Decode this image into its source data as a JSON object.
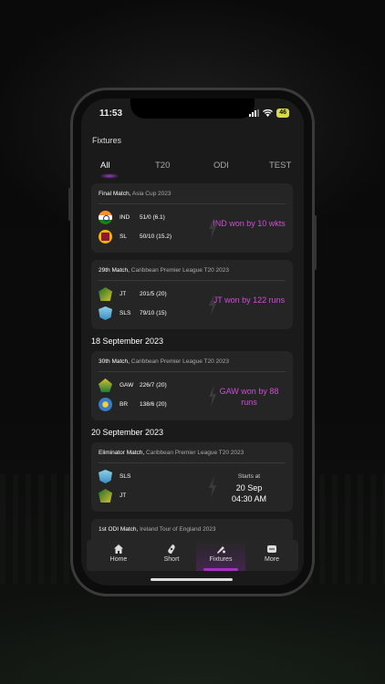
{
  "status": {
    "time": "11:53",
    "battery": "46"
  },
  "header": {
    "title": "Fixtures"
  },
  "tabs": [
    {
      "label": "All"
    },
    {
      "label": "T20"
    },
    {
      "label": "ODI"
    },
    {
      "label": "TEST"
    }
  ],
  "matches": [
    {
      "title": "Final Match,",
      "league": "Asia Cup 2023",
      "team1": {
        "abbr": "IND",
        "score": "51/0 (6.1)"
      },
      "team2": {
        "abbr": "SL",
        "score": "50/10 (15.2)"
      },
      "result": "IND won by 10 wkts"
    },
    {
      "title": "29th Match,",
      "league": "Caribbean Premier League T20 2023",
      "team1": {
        "abbr": "JT",
        "score": "201/5 (20)"
      },
      "team2": {
        "abbr": "SLS",
        "score": "79/10 (15)"
      },
      "result": "JT won by 122 runs"
    },
    {
      "title": "30th Match,",
      "league": "Caribbean Premier League T20 2023",
      "team1": {
        "abbr": "GAW",
        "score": "226/7 (20)"
      },
      "team2": {
        "abbr": "BR",
        "score": "138/6 (20)"
      },
      "result": "GAW won by 88 runs"
    },
    {
      "title": "Eliminator Match,",
      "league": "Caribbean Premier League T20 2023",
      "team1": {
        "abbr": "SLS",
        "score": ""
      },
      "team2": {
        "abbr": "JT",
        "score": ""
      },
      "starts_label": "Starts at",
      "start_date": "20 Sep",
      "start_time": "04:30 AM"
    },
    {
      "title": "1st ODI Match,",
      "league": "Ireland Tour of England 2023"
    }
  ],
  "date_headings": [
    "18 September 2023",
    "20 September 2023"
  ],
  "nav": [
    {
      "label": "Home"
    },
    {
      "label": "Short"
    },
    {
      "label": "Fixtures"
    },
    {
      "label": "More"
    }
  ],
  "colors": {
    "accent": "#d24bd8",
    "nav_active": "#a82ec8"
  }
}
